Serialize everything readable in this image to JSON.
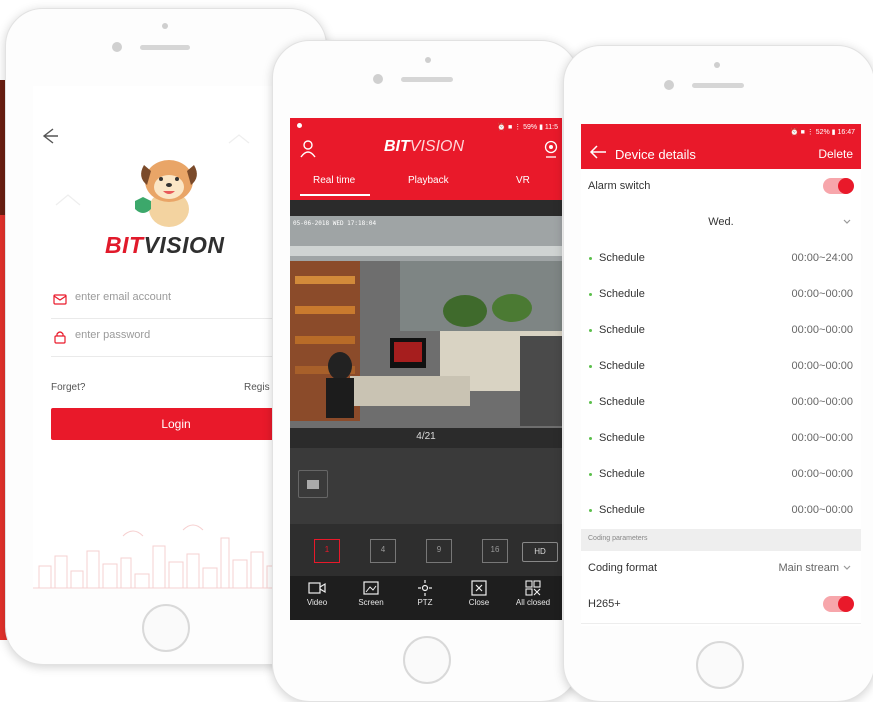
{
  "colors": {
    "brand_red": "#e9192a",
    "dark_panel": "#2b2b2b",
    "toggle_on": "#e9192a",
    "schedule_bullet": "#5bbf4b"
  },
  "login": {
    "logo_bold": "BIT",
    "logo_rest": "VISION",
    "email_placeholder": "enter email account",
    "password_placeholder": "enter password",
    "forget": "Forget?",
    "register": "Regis",
    "login_button": "Login",
    "icons": {
      "back": "back-arrow-icon",
      "email": "mail-icon",
      "password": "lock-icon"
    }
  },
  "live": {
    "status": "⏰ ■ ⋮ 59% ▮ 11:5",
    "logo_bold": "BIT",
    "logo_rest": "VISION",
    "tabs": [
      "Real time",
      "Playback",
      "VR"
    ],
    "timestamp": "05-06-2018 WED 17:18:04",
    "pager": "4/21",
    "grid_buttons": [
      "1",
      "4",
      "9",
      "16"
    ],
    "hd_label": "HD",
    "toolbar": [
      "Video",
      "Screen",
      "PTZ",
      "Close",
      "All closed"
    ]
  },
  "details": {
    "status": "⏰ ■ ⋮ 52% ▮ 16:47",
    "title": "Device details",
    "delete": "Delete",
    "alarm_switch": {
      "label": "Alarm switch",
      "on": true
    },
    "day": "Wed.",
    "schedules": [
      {
        "label": "Schedule",
        "time": "00:00~24:00"
      },
      {
        "label": "Schedule",
        "time": "00:00~00:00"
      },
      {
        "label": "Schedule",
        "time": "00:00~00:00"
      },
      {
        "label": "Schedule",
        "time": "00:00~00:00"
      },
      {
        "label": "Schedule",
        "time": "00:00~00:00"
      },
      {
        "label": "Schedule",
        "time": "00:00~00:00"
      },
      {
        "label": "Schedule",
        "time": "00:00~00:00"
      },
      {
        "label": "Schedule",
        "time": "00:00~00:00"
      }
    ],
    "section": "Coding parameters",
    "coding_format": {
      "label": "Coding format",
      "value": "Main stream"
    },
    "h265": {
      "label": "H265+",
      "on": true
    }
  }
}
